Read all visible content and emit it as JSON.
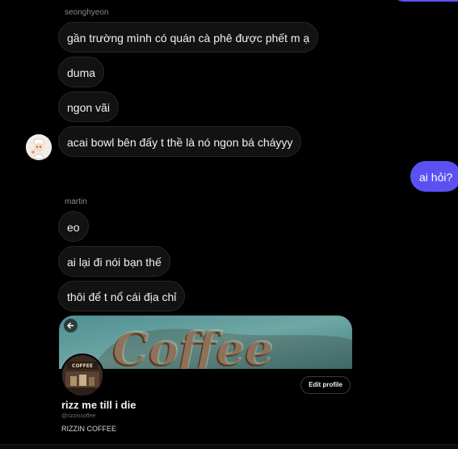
{
  "colors": {
    "background": "#000000",
    "received_bubble": "#121212",
    "sent_bubble": "#5b51f2",
    "text": "#f2f2f2",
    "muted_text": "#8a8a8a"
  },
  "thread": [
    {
      "sender": "seonghyeon",
      "messages": [
        "gần trường mình có quán cà phê được phết m ạ",
        "duma",
        "ngon vãi",
        "acai bowl bên đấy t thề là nó ngon bá cháyyy"
      ]
    },
    {
      "sent": "ai hỏi?"
    },
    {
      "sender": "martin",
      "messages": [
        "eo",
        "ai lại đi nói bạn thế",
        "thôi để t nổ cái địa chỉ"
      ]
    }
  ],
  "shared_profile": {
    "banner_icon": "back-arrow-icon",
    "avatar_text": "COFFEE",
    "edit_button": "Edit profile",
    "name": "rizz me till i die",
    "handle": "@rizzincoffee",
    "bio": "RIZZIN COFFEE"
  }
}
